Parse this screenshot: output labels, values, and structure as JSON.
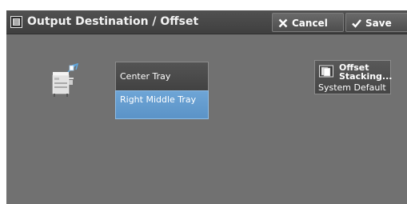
{
  "header": {
    "title": "Output Destination / Offset",
    "cancel_label": "Cancel",
    "save_label": "Save",
    "title_icon": "document-icon",
    "cancel_icon": "close-icon",
    "save_icon": "checkmark-icon"
  },
  "output_destination": {
    "device_icon": "printer-output-icon",
    "options": [
      {
        "label": "Center Tray",
        "selected": false
      },
      {
        "label": "Right Middle Tray",
        "selected": true
      }
    ]
  },
  "offset": {
    "label": "Offset Stacking...",
    "value": "System Default",
    "icon": "offset-stack-icon"
  },
  "colors": {
    "panel_bg": "#717171",
    "header_bg": "#474747",
    "selected": "#5f98cc",
    "button_bg": "#4e4e4e"
  }
}
